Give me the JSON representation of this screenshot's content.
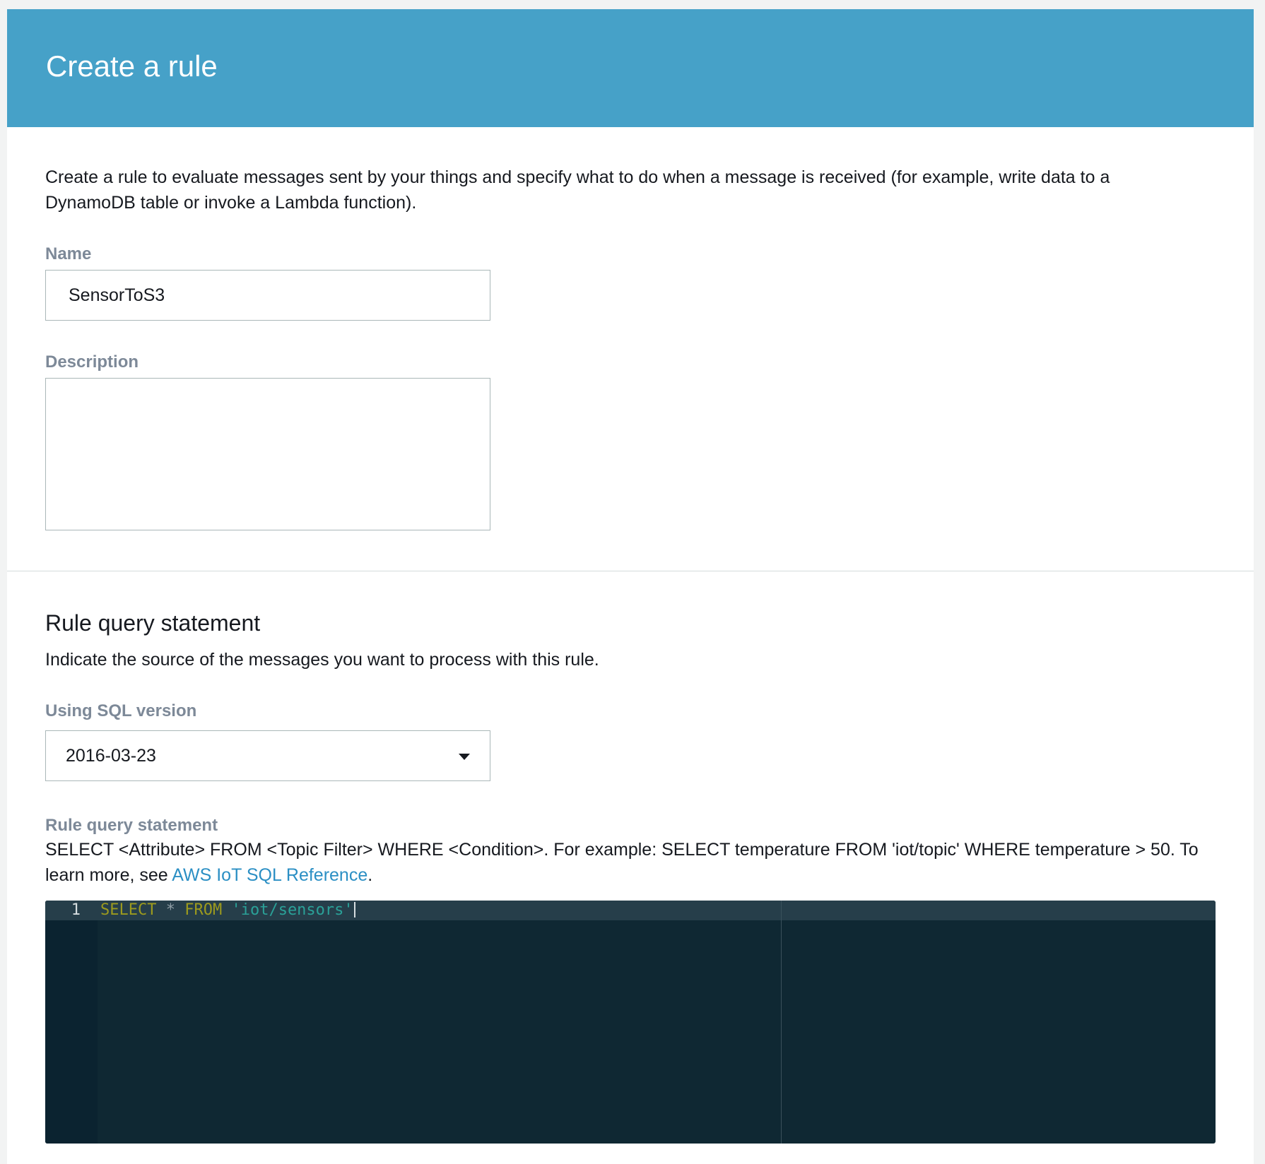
{
  "header": {
    "title": "Create a rule"
  },
  "intro": {
    "text": "Create a rule to evaluate messages sent by your things and specify what to do when a message is received (for example, write data to a DynamoDB table or invoke a Lambda function)."
  },
  "name_field": {
    "label": "Name",
    "value": "SensorToS3"
  },
  "description_field": {
    "label": "Description",
    "value": ""
  },
  "rule_query_section": {
    "title": "Rule query statement",
    "description": "Indicate the source of the messages you want to process with this rule.",
    "sql_version": {
      "label": "Using SQL version",
      "selected": "2016-03-23"
    },
    "statement": {
      "label": "Rule query statement",
      "help_text": "SELECT <Attribute> FROM <Topic Filter> WHERE <Condition>. For example: SELECT temperature FROM 'iot/topic' WHERE temperature > 50. To learn more, see ",
      "link_text": "AWS IoT SQL Reference",
      "help_suffix": "."
    },
    "editor": {
      "line_number": "1",
      "tokens": {
        "select": "SELECT",
        "star": "*",
        "from": "FROM",
        "topic": "'iot/sensors'"
      }
    }
  },
  "colors": {
    "header_bg": "#46a1c8",
    "link": "#2b8fc4",
    "editor_bg": "#0f2833",
    "keyword": "#9c9a1e",
    "string": "#2aa198"
  }
}
